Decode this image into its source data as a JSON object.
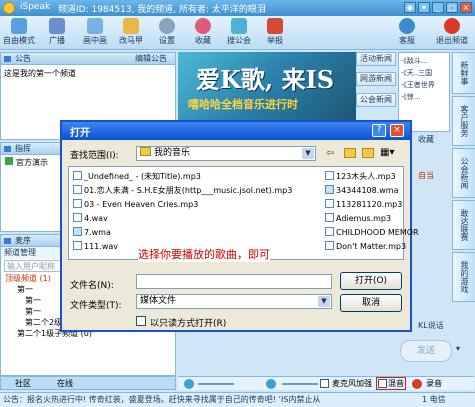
{
  "titlebar": {
    "app_name": "iSpeak",
    "channel_info": "频道ID: 1984513, 我的频道, 所有者: 太平洋的眼泪"
  },
  "toolbar": {
    "items": [
      {
        "label": "自由模式",
        "icon": "mic-icon"
      },
      {
        "label": "广播",
        "icon": "broadcast-icon"
      },
      {
        "label": "画中画",
        "icon": "picture-in-picture-icon"
      },
      {
        "label": "改马甲",
        "icon": "user-edit-icon"
      },
      {
        "label": "设置",
        "icon": "gear-icon"
      },
      {
        "label": "收藏",
        "icon": "heart-icon"
      },
      {
        "label": "搜公会",
        "icon": "search-icon"
      },
      {
        "label": "举报",
        "icon": "report-icon"
      },
      {
        "label": "客服",
        "icon": "headset-icon"
      },
      {
        "label": "退出频道",
        "icon": "exit-icon"
      }
    ]
  },
  "announcement": {
    "title": "公告",
    "edit_label": "编辑公告",
    "text": "这是我的第一个频道"
  },
  "leader": {
    "title": "指挥",
    "member": "官方演示"
  },
  "mic_queue": {
    "title": "麦序",
    "manage_label": "频道管理",
    "search_placeholder": "输入用户昵称",
    "tree": [
      "顶级频道 (1)",
      "第一",
      "第一",
      "第一",
      "第二个2级子频道 (0)",
      "第二个1级子频道 (0)"
    ]
  },
  "bottom_tabs": [
    "社区",
    "在线"
  ],
  "banner": {
    "big_text": "爱K歌, 来IS",
    "sub_text": "嘻哈哈全档音乐进行时"
  },
  "side_news": [
    "活动新闻",
    "网游新闻",
    "公会新闻"
  ],
  "right_tabs": [
    "新鲜事",
    "客户服务",
    "公会新闻",
    "敢达联赛",
    "我的游戏"
  ],
  "chat_side": {
    "favorite": "收藏",
    "recharge_hint": "自当",
    "kl_label": "KL说话",
    "send_label": "发送",
    "dropdown_label": "发送▾"
  },
  "controls": {
    "mic_boost": "麦克风加强",
    "mix": "混音",
    "record": "录音"
  },
  "dialog": {
    "title": "打开",
    "look_in_label": "查找范围(I):",
    "look_in_value": "我的音乐",
    "files_left": [
      "_Undefined_ - (未知Title).mp3",
      "01.恋人未满 - S.H.E女朋友(http___music.jsol.net).mp3",
      "03 - Even Heaven Cries.mp3",
      "4.wav",
      "7.wma",
      "111.wav"
    ],
    "files_right": [
      "123木头人.mp3",
      "34344108.wma",
      "113281120.mp3",
      "Adiemus.mp3",
      "CHILDHOOD MEMOR",
      "Don't Matter.mp3"
    ],
    "hint": "选择你要播放的歌曲，即可",
    "filename_label": "文件名(N):",
    "filename_value": "",
    "filetype_label": "文件类型(T):",
    "filetype_value": "媒体文件",
    "readonly_label": "以只读方式打开(R)",
    "open_label": "打开(O)",
    "cancel_label": "取消"
  },
  "statusbar": {
    "text": "公告：报名火热进行中!  传奇红装，盛夏登场。赶快来寻找属于自己的传奇吧!  ‘IS内禁止从",
    "signal": "1 电信"
  },
  "colors": {
    "titlebar": "#3f8fd0",
    "dialog_title": "#0a52d6",
    "hint_red": "#cc0000",
    "accent": "#86b7df"
  }
}
